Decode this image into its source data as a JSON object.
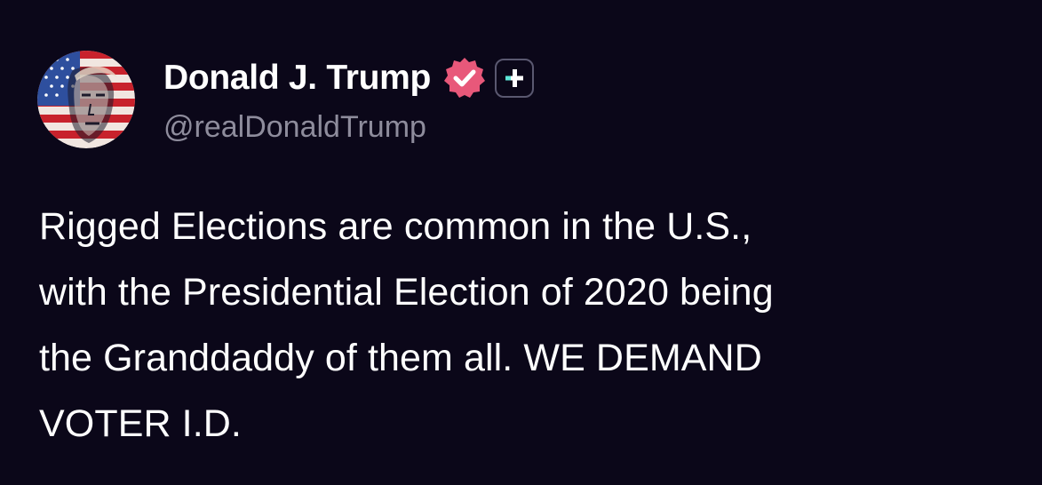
{
  "post": {
    "author": {
      "display_name": "Donald J. Trump",
      "handle": "@realDonaldTrump",
      "avatar_icon": "flag-portrait-avatar",
      "verified_icon": "verified-badge-icon",
      "plus_icon": "plus-badge-icon"
    },
    "text_lines": [
      "Rigged Elections are common in the U.S.,",
      "with the Presidential Election of 2020 being",
      "the Granddaddy of them all. WE DEMAND",
      "VOTER I.D."
    ]
  },
  "theme": {
    "background": "#0b0719",
    "text": "#ffffff",
    "handle": "#8e8c9c",
    "verified_badge": "#e8587a",
    "plus_accent": "#5ee6d8"
  }
}
